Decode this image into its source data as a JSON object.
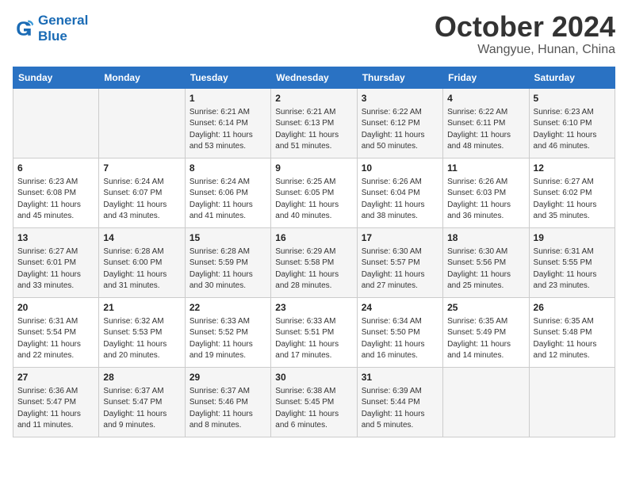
{
  "header": {
    "logo_line1": "General",
    "logo_line2": "Blue",
    "month": "October 2024",
    "location": "Wangyue, Hunan, China"
  },
  "weekdays": [
    "Sunday",
    "Monday",
    "Tuesday",
    "Wednesday",
    "Thursday",
    "Friday",
    "Saturday"
  ],
  "weeks": [
    [
      {
        "day": "",
        "detail": ""
      },
      {
        "day": "",
        "detail": ""
      },
      {
        "day": "1",
        "detail": "Sunrise: 6:21 AM\nSunset: 6:14 PM\nDaylight: 11 hours\nand 53 minutes."
      },
      {
        "day": "2",
        "detail": "Sunrise: 6:21 AM\nSunset: 6:13 PM\nDaylight: 11 hours\nand 51 minutes."
      },
      {
        "day": "3",
        "detail": "Sunrise: 6:22 AM\nSunset: 6:12 PM\nDaylight: 11 hours\nand 50 minutes."
      },
      {
        "day": "4",
        "detail": "Sunrise: 6:22 AM\nSunset: 6:11 PM\nDaylight: 11 hours\nand 48 minutes."
      },
      {
        "day": "5",
        "detail": "Sunrise: 6:23 AM\nSunset: 6:10 PM\nDaylight: 11 hours\nand 46 minutes."
      }
    ],
    [
      {
        "day": "6",
        "detail": "Sunrise: 6:23 AM\nSunset: 6:08 PM\nDaylight: 11 hours\nand 45 minutes."
      },
      {
        "day": "7",
        "detail": "Sunrise: 6:24 AM\nSunset: 6:07 PM\nDaylight: 11 hours\nand 43 minutes."
      },
      {
        "day": "8",
        "detail": "Sunrise: 6:24 AM\nSunset: 6:06 PM\nDaylight: 11 hours\nand 41 minutes."
      },
      {
        "day": "9",
        "detail": "Sunrise: 6:25 AM\nSunset: 6:05 PM\nDaylight: 11 hours\nand 40 minutes."
      },
      {
        "day": "10",
        "detail": "Sunrise: 6:26 AM\nSunset: 6:04 PM\nDaylight: 11 hours\nand 38 minutes."
      },
      {
        "day": "11",
        "detail": "Sunrise: 6:26 AM\nSunset: 6:03 PM\nDaylight: 11 hours\nand 36 minutes."
      },
      {
        "day": "12",
        "detail": "Sunrise: 6:27 AM\nSunset: 6:02 PM\nDaylight: 11 hours\nand 35 minutes."
      }
    ],
    [
      {
        "day": "13",
        "detail": "Sunrise: 6:27 AM\nSunset: 6:01 PM\nDaylight: 11 hours\nand 33 minutes."
      },
      {
        "day": "14",
        "detail": "Sunrise: 6:28 AM\nSunset: 6:00 PM\nDaylight: 11 hours\nand 31 minutes."
      },
      {
        "day": "15",
        "detail": "Sunrise: 6:28 AM\nSunset: 5:59 PM\nDaylight: 11 hours\nand 30 minutes."
      },
      {
        "day": "16",
        "detail": "Sunrise: 6:29 AM\nSunset: 5:58 PM\nDaylight: 11 hours\nand 28 minutes."
      },
      {
        "day": "17",
        "detail": "Sunrise: 6:30 AM\nSunset: 5:57 PM\nDaylight: 11 hours\nand 27 minutes."
      },
      {
        "day": "18",
        "detail": "Sunrise: 6:30 AM\nSunset: 5:56 PM\nDaylight: 11 hours\nand 25 minutes."
      },
      {
        "day": "19",
        "detail": "Sunrise: 6:31 AM\nSunset: 5:55 PM\nDaylight: 11 hours\nand 23 minutes."
      }
    ],
    [
      {
        "day": "20",
        "detail": "Sunrise: 6:31 AM\nSunset: 5:54 PM\nDaylight: 11 hours\nand 22 minutes."
      },
      {
        "day": "21",
        "detail": "Sunrise: 6:32 AM\nSunset: 5:53 PM\nDaylight: 11 hours\nand 20 minutes."
      },
      {
        "day": "22",
        "detail": "Sunrise: 6:33 AM\nSunset: 5:52 PM\nDaylight: 11 hours\nand 19 minutes."
      },
      {
        "day": "23",
        "detail": "Sunrise: 6:33 AM\nSunset: 5:51 PM\nDaylight: 11 hours\nand 17 minutes."
      },
      {
        "day": "24",
        "detail": "Sunrise: 6:34 AM\nSunset: 5:50 PM\nDaylight: 11 hours\nand 16 minutes."
      },
      {
        "day": "25",
        "detail": "Sunrise: 6:35 AM\nSunset: 5:49 PM\nDaylight: 11 hours\nand 14 minutes."
      },
      {
        "day": "26",
        "detail": "Sunrise: 6:35 AM\nSunset: 5:48 PM\nDaylight: 11 hours\nand 12 minutes."
      }
    ],
    [
      {
        "day": "27",
        "detail": "Sunrise: 6:36 AM\nSunset: 5:47 PM\nDaylight: 11 hours\nand 11 minutes."
      },
      {
        "day": "28",
        "detail": "Sunrise: 6:37 AM\nSunset: 5:47 PM\nDaylight: 11 hours\nand 9 minutes."
      },
      {
        "day": "29",
        "detail": "Sunrise: 6:37 AM\nSunset: 5:46 PM\nDaylight: 11 hours\nand 8 minutes."
      },
      {
        "day": "30",
        "detail": "Sunrise: 6:38 AM\nSunset: 5:45 PM\nDaylight: 11 hours\nand 6 minutes."
      },
      {
        "day": "31",
        "detail": "Sunrise: 6:39 AM\nSunset: 5:44 PM\nDaylight: 11 hours\nand 5 minutes."
      },
      {
        "day": "",
        "detail": ""
      },
      {
        "day": "",
        "detail": ""
      }
    ]
  ]
}
